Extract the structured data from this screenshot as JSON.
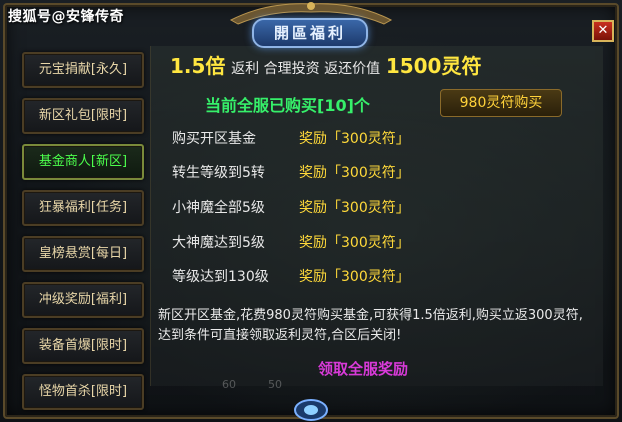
{
  "watermark": "搜狐号@安锋传奇",
  "window": {
    "title": "開區福利",
    "close_label": "✕"
  },
  "sidebar": {
    "items": [
      {
        "label": "元宝捐献[永久]",
        "active": false
      },
      {
        "label": "新区礼包[限时]",
        "active": false
      },
      {
        "label": "基金商人[新区]",
        "active": true
      },
      {
        "label": "狂暴福利[任务]",
        "active": false
      },
      {
        "label": "皇榜悬赏[每日]",
        "active": false
      },
      {
        "label": "冲级奖励[福利]",
        "active": false
      },
      {
        "label": "装备首爆[限时]",
        "active": false
      },
      {
        "label": "怪物首杀[限时]",
        "active": false
      }
    ]
  },
  "headline": {
    "multiplier": "1.5倍",
    "rebate_text": "返利 合理投资 返还价值",
    "value": "1500灵符"
  },
  "bought_text": "当前全服已购买[10]个",
  "buy_button": "980灵符购买",
  "tasks": [
    {
      "name": "购买开区基金",
      "reward": "奖励「300灵符」"
    },
    {
      "name": "转生等级到5转",
      "reward": "奖励「300灵符」"
    },
    {
      "name": "小神魔全部5级",
      "reward": "奖励「300灵符」"
    },
    {
      "name": "大神魔达到5级",
      "reward": "奖励「300灵符」"
    },
    {
      "name": "等级达到130级",
      "reward": "奖励「300灵符」"
    }
  ],
  "description": "新区开区基金,花费980灵符购买基金,可获得1.5倍返利,购买立返300灵符,达到条件可直接领取返利灵符,合区后关闭!",
  "claim_button": "领取全服奖励",
  "background_numbers": [
    "60",
    "50"
  ]
}
